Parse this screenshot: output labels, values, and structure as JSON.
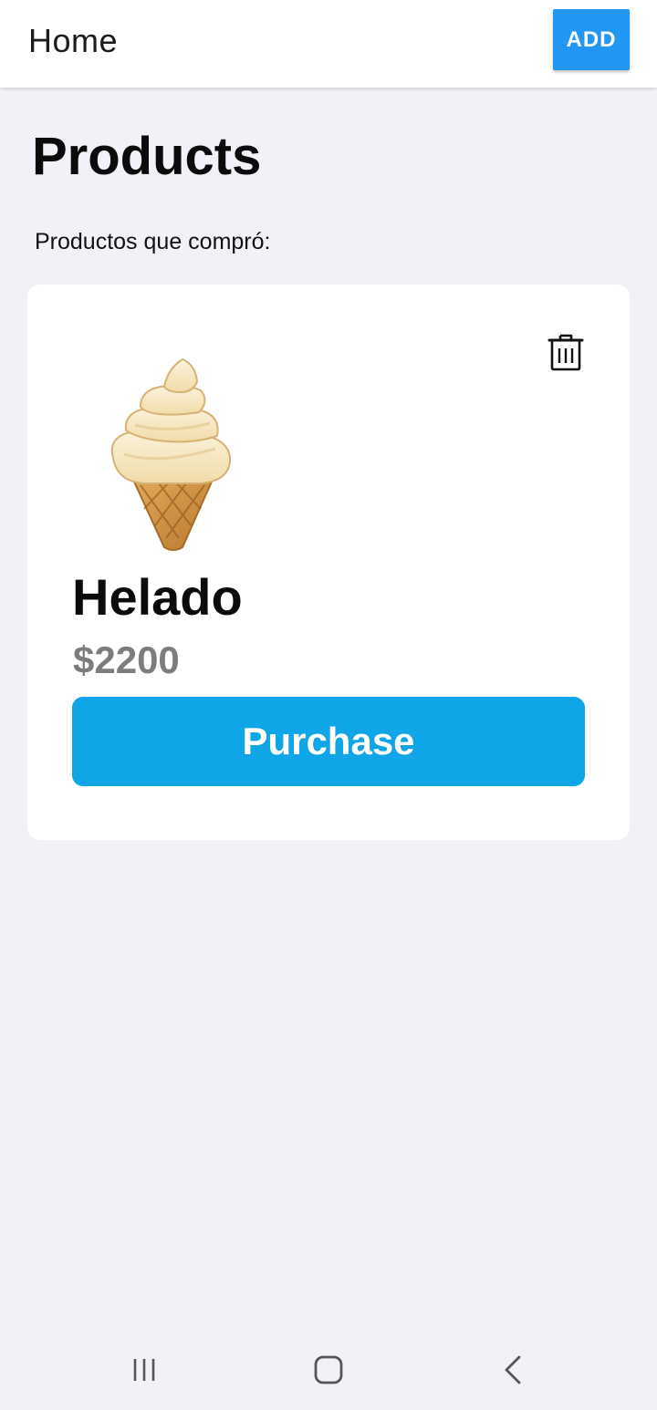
{
  "app_bar": {
    "title": "Home",
    "add_button_label": "ADD",
    "accent_color": "#2196f3"
  },
  "main": {
    "heading": "Products",
    "subheading": "Productos que compró:"
  },
  "products": [
    {
      "image_icon": "ice-cream-cone-icon",
      "name": "Helado",
      "price": "$2200",
      "purchase_label": "Purchase",
      "delete_icon": "trash-icon",
      "button_color": "#10a5e6"
    }
  ],
  "system_nav": {
    "icons": [
      "recent-apps-icon",
      "home-icon",
      "back-icon"
    ]
  }
}
